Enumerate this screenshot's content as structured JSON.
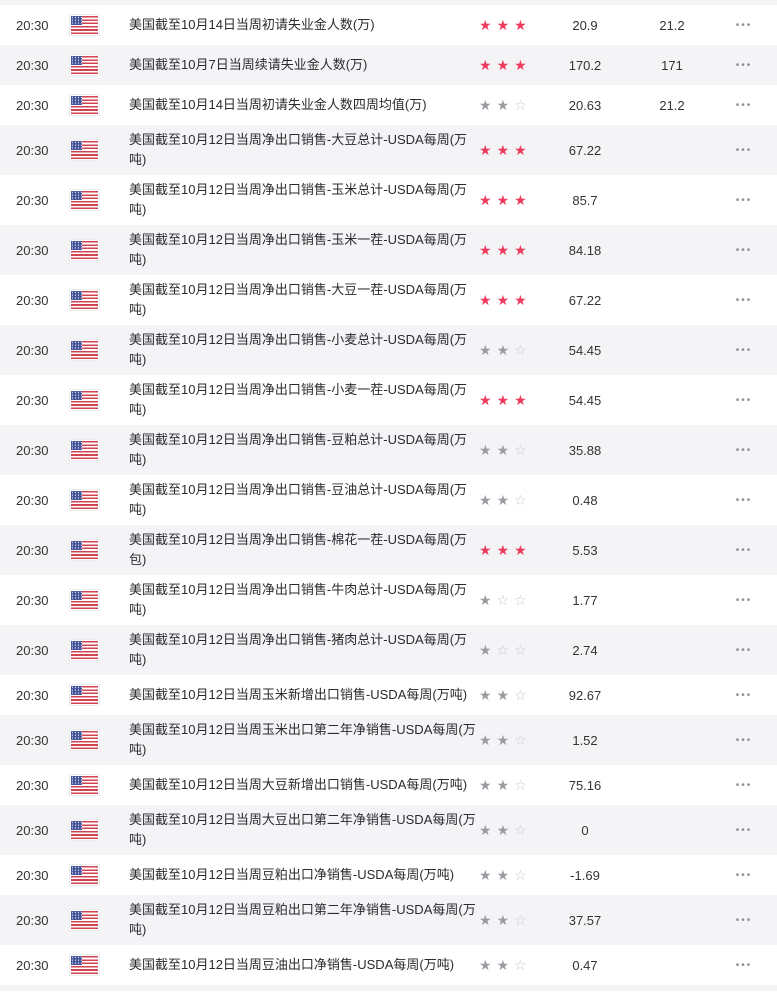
{
  "colors": {
    "star_high": "#ee3a5c",
    "star_low": "#9b9ba2",
    "star_outline": "#c9c9d0",
    "row_alt_bg": "#f4f4f6",
    "flag_red": "#d04350",
    "flag_blue": "#44549b"
  },
  "icons": {
    "star_filled": "★",
    "star_outline": "☆",
    "more": "•••",
    "flag": "us-flag"
  },
  "calendar": {
    "max_stars": 3,
    "rows": [
      {
        "time": "20:30",
        "country": "US",
        "title": "美国截至10月14日当周初请失业金人数(万)",
        "stars": 3,
        "actual": "20.9",
        "previous": "21.2"
      },
      {
        "time": "20:30",
        "country": "US",
        "title": "美国截至10月7日当周续请失业金人数(万)",
        "stars": 3,
        "actual": "170.2",
        "previous": "171"
      },
      {
        "time": "20:30",
        "country": "US",
        "title": "美国截至10月14日当周初请失业金人数四周均值(万)",
        "stars": 2,
        "actual": "20.63",
        "previous": "21.2"
      },
      {
        "time": "20:30",
        "country": "US",
        "title": "美国截至10月12日当周净出口销售-大豆总计-USDA每周(万吨)",
        "stars": 3,
        "actual": "67.22",
        "previous": ""
      },
      {
        "time": "20:30",
        "country": "US",
        "title": "美国截至10月12日当周净出口销售-玉米总计-USDA每周(万吨)",
        "stars": 3,
        "actual": "85.7",
        "previous": ""
      },
      {
        "time": "20:30",
        "country": "US",
        "title": "美国截至10月12日当周净出口销售-玉米一茬-USDA每周(万吨)",
        "stars": 3,
        "actual": "84.18",
        "previous": ""
      },
      {
        "time": "20:30",
        "country": "US",
        "title": "美国截至10月12日当周净出口销售-大豆一茬-USDA每周(万吨)",
        "stars": 3,
        "actual": "67.22",
        "previous": ""
      },
      {
        "time": "20:30",
        "country": "US",
        "title": "美国截至10月12日当周净出口销售-小麦总计-USDA每周(万吨)",
        "stars": 2,
        "actual": "54.45",
        "previous": ""
      },
      {
        "time": "20:30",
        "country": "US",
        "title": "美国截至10月12日当周净出口销售-小麦一茬-USDA每周(万吨)",
        "stars": 3,
        "actual": "54.45",
        "previous": ""
      },
      {
        "time": "20:30",
        "country": "US",
        "title": "美国截至10月12日当周净出口销售-豆粕总计-USDA每周(万吨)",
        "stars": 2,
        "actual": "35.88",
        "previous": ""
      },
      {
        "time": "20:30",
        "country": "US",
        "title": "美国截至10月12日当周净出口销售-豆油总计-USDA每周(万吨)",
        "stars": 2,
        "actual": "0.48",
        "previous": ""
      },
      {
        "time": "20:30",
        "country": "US",
        "title": "美国截至10月12日当周净出口销售-棉花一茬-USDA每周(万包)",
        "stars": 3,
        "actual": "5.53",
        "previous": ""
      },
      {
        "time": "20:30",
        "country": "US",
        "title": "美国截至10月12日当周净出口销售-牛肉总计-USDA每周(万吨)",
        "stars": 1,
        "actual": "1.77",
        "previous": ""
      },
      {
        "time": "20:30",
        "country": "US",
        "title": "美国截至10月12日当周净出口销售-猪肉总计-USDA每周(万吨)",
        "stars": 1,
        "actual": "2.74",
        "previous": ""
      },
      {
        "time": "20:30",
        "country": "US",
        "title": "美国截至10月12日当周玉米新增出口销售-USDA每周(万吨)",
        "stars": 2,
        "actual": "92.67",
        "previous": ""
      },
      {
        "time": "20:30",
        "country": "US",
        "title": "美国截至10月12日当周玉米出口第二年净销售-USDA每周(万吨)",
        "stars": 2,
        "actual": "1.52",
        "previous": ""
      },
      {
        "time": "20:30",
        "country": "US",
        "title": "美国截至10月12日当周大豆新增出口销售-USDA每周(万吨)",
        "stars": 2,
        "actual": "75.16",
        "previous": ""
      },
      {
        "time": "20:30",
        "country": "US",
        "title": "美国截至10月12日当周大豆出口第二年净销售-USDA每周(万吨)",
        "stars": 2,
        "actual": "0",
        "previous": ""
      },
      {
        "time": "20:30",
        "country": "US",
        "title": "美国截至10月12日当周豆粕出口净销售-USDA每周(万吨)",
        "stars": 2,
        "actual": "-1.69",
        "previous": ""
      },
      {
        "time": "20:30",
        "country": "US",
        "title": "美国截至10月12日当周豆粕出口第二年净销售-USDA每周(万吨)",
        "stars": 2,
        "actual": "37.57",
        "previous": ""
      },
      {
        "time": "20:30",
        "country": "US",
        "title": "美国截至10月12日当周豆油出口净销售-USDA每周(万吨)",
        "stars": 2,
        "actual": "0.47",
        "previous": ""
      }
    ]
  }
}
